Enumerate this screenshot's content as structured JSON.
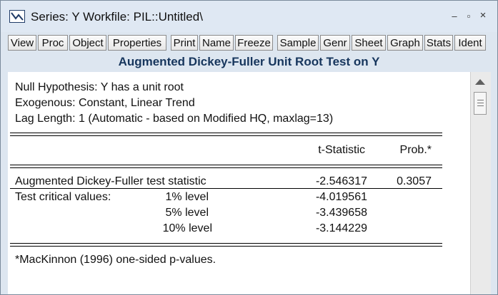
{
  "window": {
    "title": "Series: Y    Workfile: PIL::Untitled\\",
    "minimize_glyph": "–",
    "restore_glyph": "▫",
    "close_glyph": "×"
  },
  "toolbar": {
    "buttons": [
      "View",
      "Proc",
      "Object",
      "Properties",
      "Print",
      "Name",
      "Freeze",
      "Sample",
      "Genr",
      "Sheet",
      "Graph",
      "Stats",
      "Ident"
    ]
  },
  "output": {
    "heading": "Augmented Dickey-Fuller Unit Root Test on Y",
    "null_hypothesis": "Null Hypothesis: Y has a unit root",
    "exogenous": "Exogenous: Constant, Linear Trend",
    "lag_length": "Lag Length: 1 (Automatic - based on Modified HQ, maxlag=13)",
    "col_t_statistic": "t-Statistic",
    "col_prob": "Prob.*",
    "adf_label": "Augmented Dickey-Fuller test statistic",
    "adf_t": "-2.546317",
    "adf_prob": "0.3057",
    "critical_label": "Test critical values:",
    "critical_values": [
      {
        "level": "1% level",
        "value": "-4.019561"
      },
      {
        "level": "5% level",
        "value": "-3.439658"
      },
      {
        "level": "10% level",
        "value": "-3.144229"
      }
    ],
    "footnote": "*MacKinnon (1996) one-sided p-values."
  },
  "icons": {
    "app": "eviews-series-icon",
    "scroll_up": "scroll-up-arrow-icon"
  }
}
